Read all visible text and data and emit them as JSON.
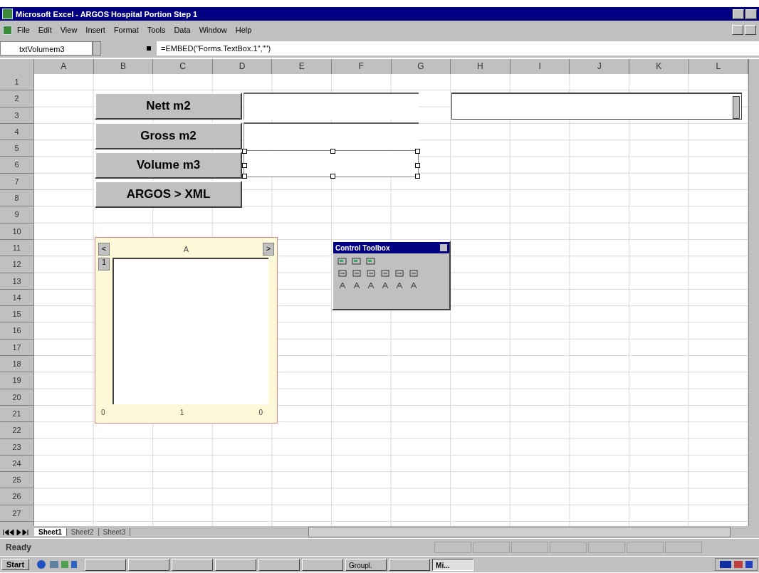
{
  "window": {
    "title": "Microsoft Excel - ARGOS Hospital Portion Step 1"
  },
  "menu": [
    "File",
    "Edit",
    "View",
    "Insert",
    "Format",
    "Tools",
    "Data",
    "Window",
    "Help"
  ],
  "name_box": {
    "value": "txtVolumem3"
  },
  "formula_bar": {
    "value": "=EMBED(\"Forms.TextBox.1\",\"\")"
  },
  "columns": [
    "A",
    "B",
    "C",
    "D",
    "E",
    "F",
    "G",
    "H",
    "I",
    "J",
    "K",
    "L"
  ],
  "rows": [
    "1",
    "2",
    "3",
    "4",
    "5",
    "6",
    "7",
    "8",
    "9",
    "10",
    "11",
    "12",
    "13",
    "14",
    "15",
    "16",
    "17",
    "18",
    "19",
    "20",
    "21",
    "22",
    "23",
    "24",
    "25",
    "26",
    "27"
  ],
  "form_buttons": [
    "Nett m2",
    "Gross m2",
    "Volume m3",
    "ARGOS > XML"
  ],
  "text_boxes": [
    {
      "selected": false
    },
    {
      "selected": false
    },
    {
      "selected": true
    }
  ],
  "embedded_sheet": {
    "scroll_buttons": [
      "<",
      ">"
    ],
    "column_header": "A",
    "row_header": "1",
    "footer": [
      "0",
      "1",
      "0"
    ]
  },
  "control_toolbox": {
    "title": "Control Toolbox"
  },
  "sheet_tabs": [
    {
      "label": "Sheet1",
      "selected": true
    },
    {
      "label": "Sheet2",
      "selected": false
    },
    {
      "label": "Sheet3",
      "selected": false
    }
  ],
  "status_bar": {
    "text": "Ready"
  },
  "taskbar": {
    "start": "Start",
    "buttons": [
      {
        "selected": false
      },
      {
        "selected": false
      },
      {
        "selected": false
      },
      {
        "selected": false
      },
      {
        "selected": false
      },
      {
        "selected": false
      },
      {
        "label": "Groupl.",
        "selected": false
      },
      {
        "selected": false
      },
      {
        "label": "Mi...",
        "selected": true
      }
    ]
  }
}
